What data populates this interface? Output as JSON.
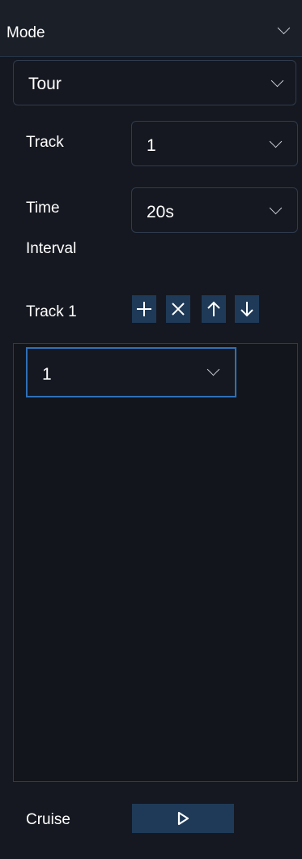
{
  "mode": {
    "label": "Mode",
    "icon": "chevron-down-icon"
  },
  "mode_select": {
    "value": "Tour",
    "icon": "chevron-down-icon"
  },
  "track": {
    "label": "Track",
    "value": "1",
    "icon": "chevron-down-icon"
  },
  "time_interval": {
    "label_line1": "Time",
    "label_line2": "Interval",
    "value": "20s",
    "icon": "chevron-down-icon"
  },
  "track_list": {
    "label": "Track 1",
    "tools": [
      "add-icon",
      "delete-icon",
      "move-up-icon",
      "move-down-icon"
    ],
    "items": [
      {
        "value": "1"
      }
    ]
  },
  "cruise": {
    "label": "Cruise",
    "icon": "play-icon"
  },
  "colors": {
    "panel_bg": "#151820",
    "accent": "#2f6fb8",
    "button_bg": "#1f3a58",
    "border": "#2f3b4d"
  }
}
